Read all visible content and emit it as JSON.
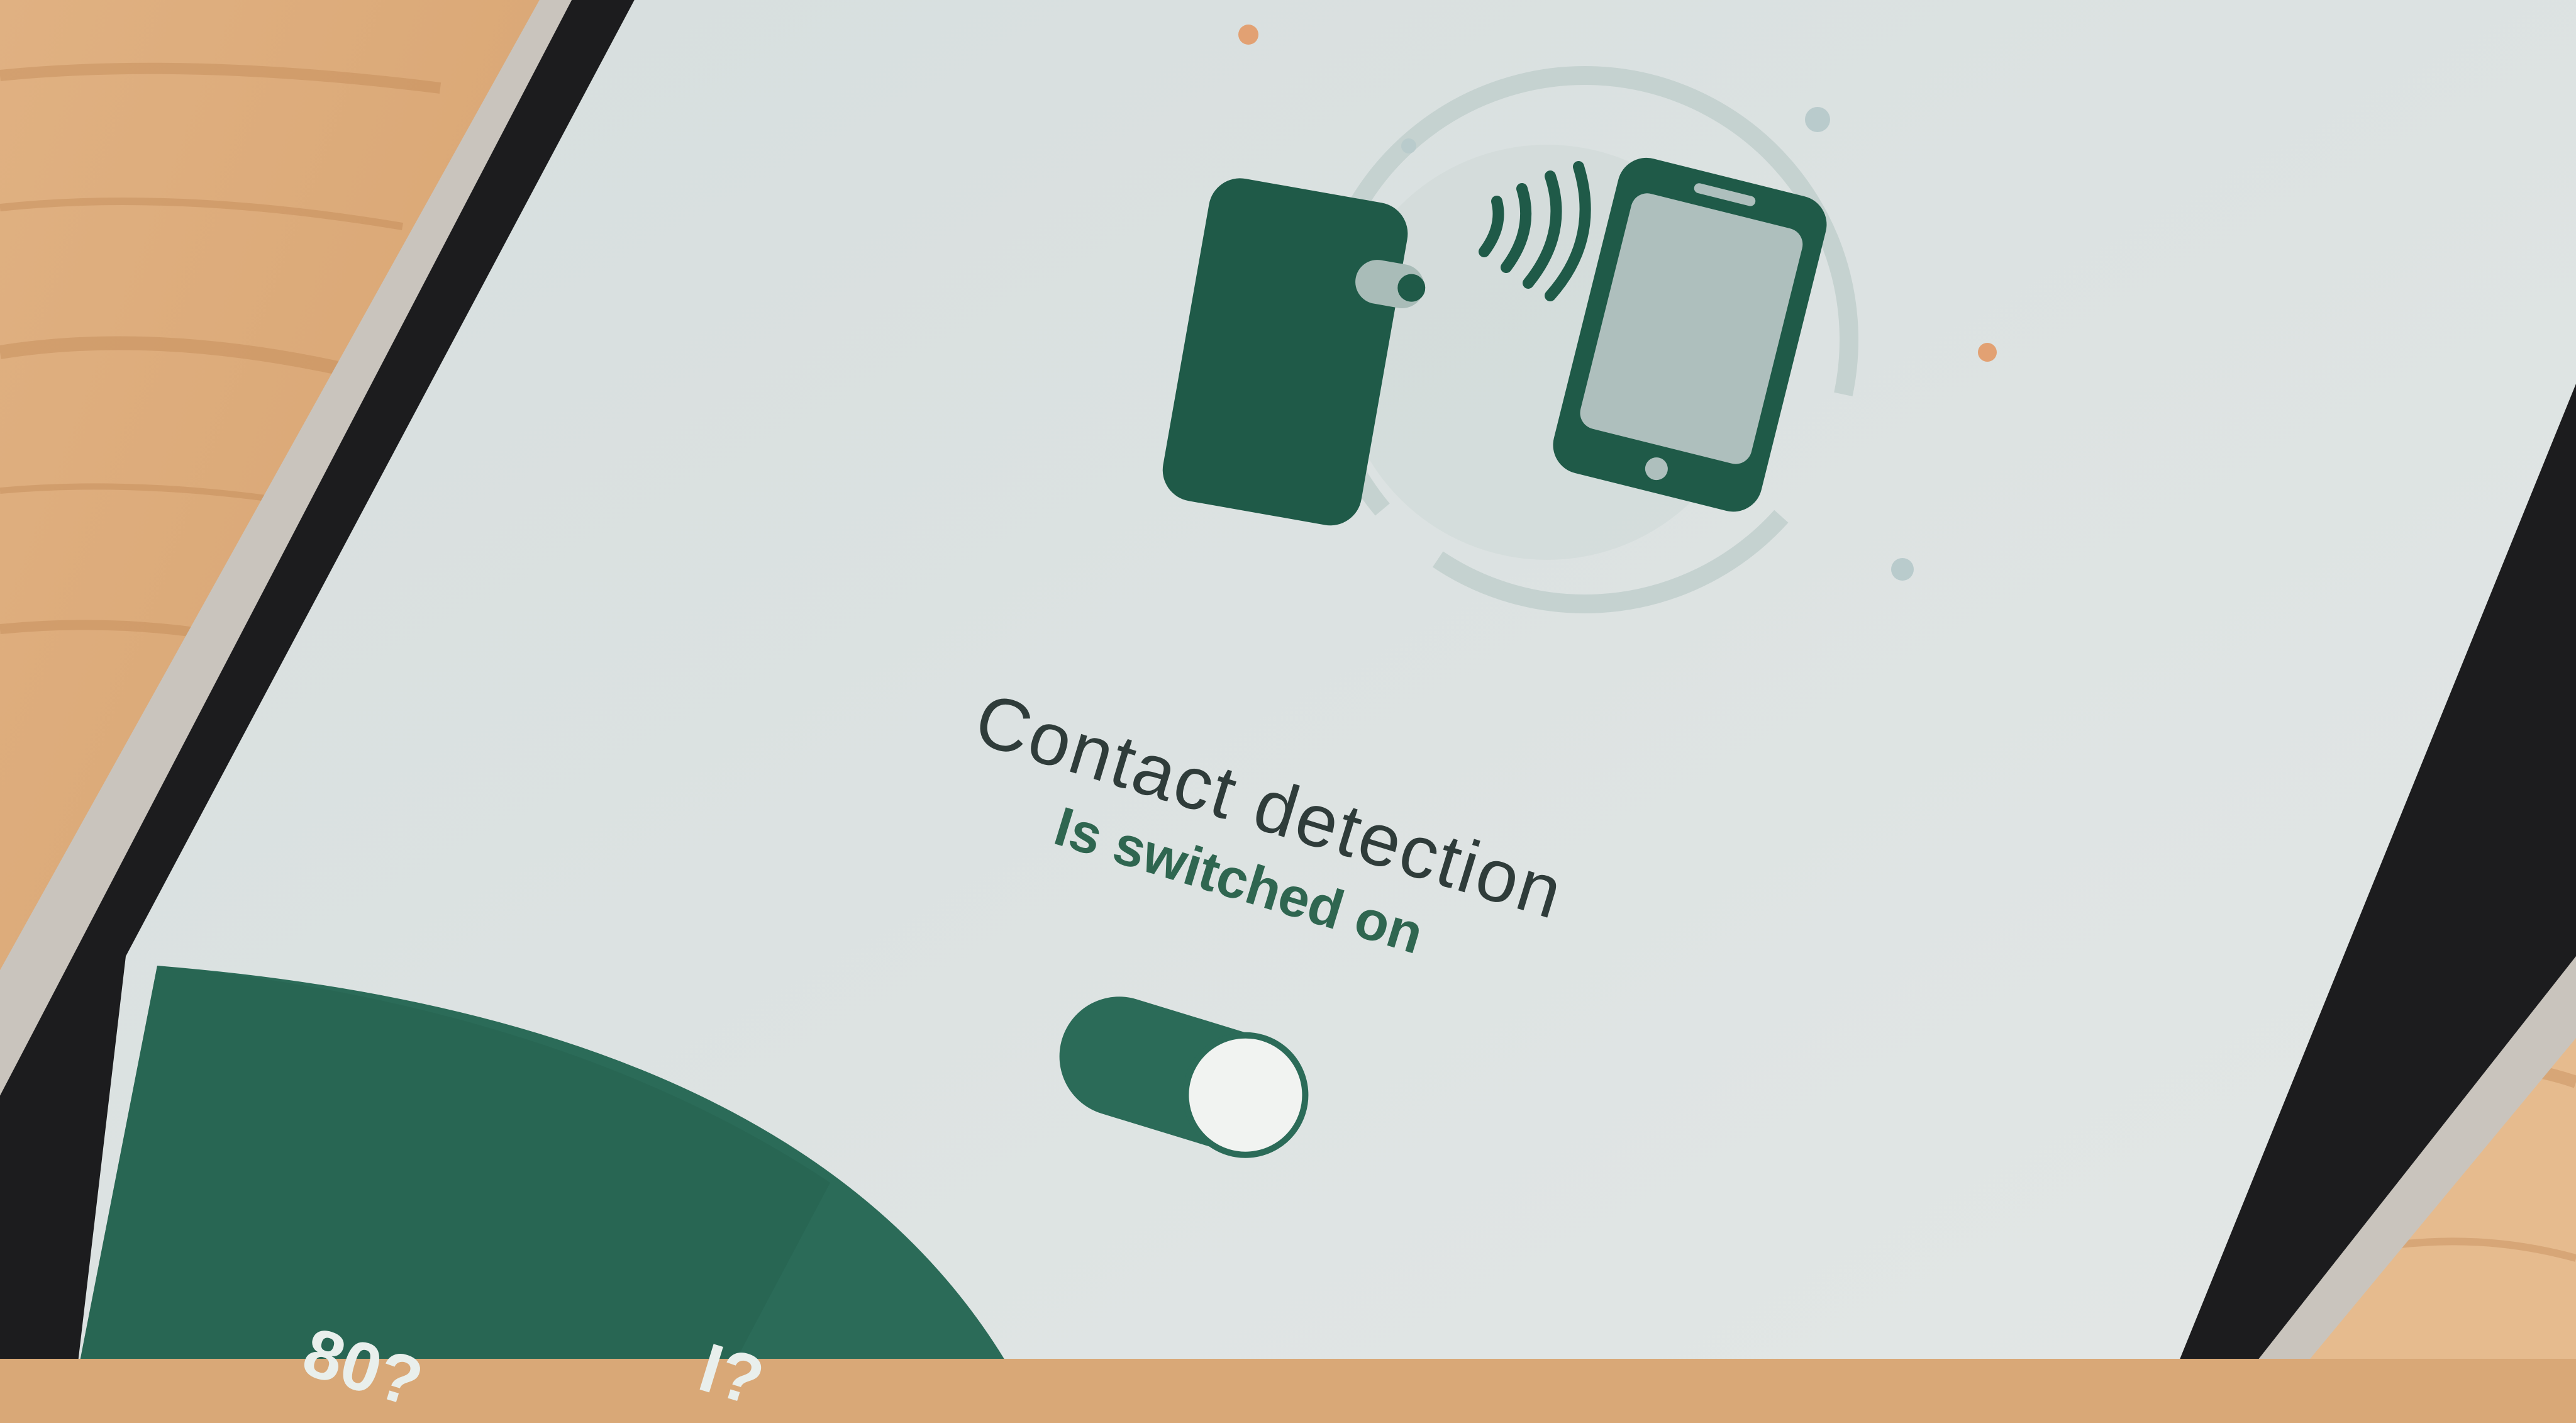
{
  "screen": {
    "title": "Contact detection",
    "status_text": "Is switched on",
    "toggle": {
      "state": "on"
    },
    "footer": {
      "partial_text_1": "80?",
      "partial_text_2": "I?"
    }
  },
  "colors": {
    "accent_green": "#2b6b58",
    "dark_green": "#1f5a48",
    "screen_bg": "#dde4e4",
    "text_dark": "#2f3c3a",
    "wood": "#d9a877",
    "orange_dot": "#e2a173"
  },
  "icons": [
    "phone-back-icon",
    "wireless-signal-icon",
    "phone-front-icon",
    "toggle-switch-icon"
  ]
}
